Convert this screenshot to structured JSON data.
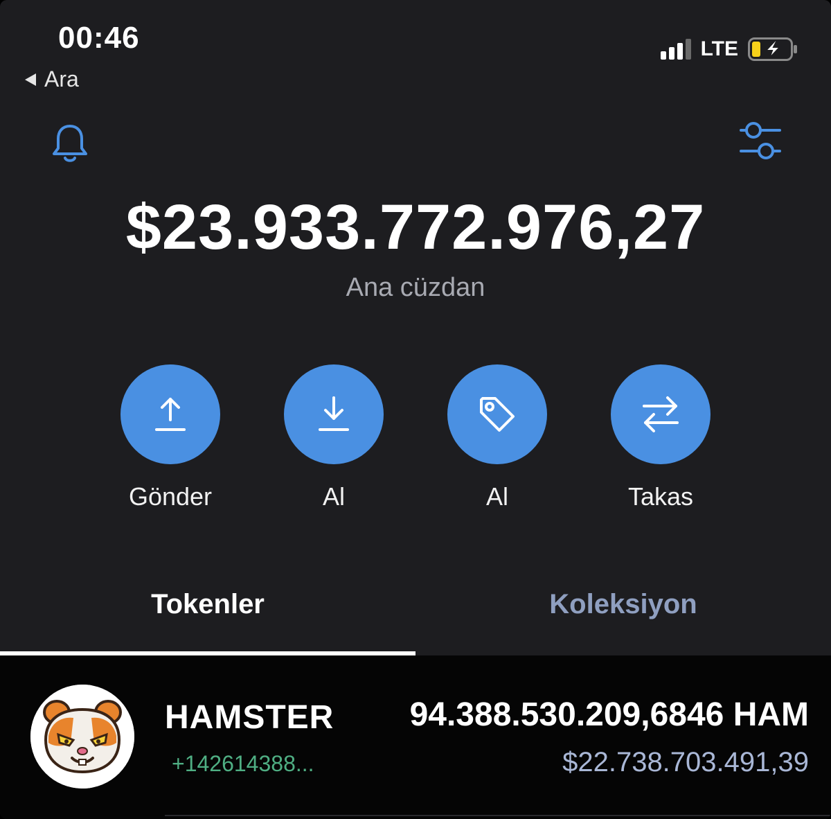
{
  "status_bar": {
    "time": "00:46",
    "back_label": "Ara",
    "network": "LTE",
    "battery_level": 0.3,
    "charging": true
  },
  "header": {
    "left_icon": "bell-icon",
    "right_icon": "sliders-icon",
    "accent_color": "#4a90e2"
  },
  "wallet": {
    "balance": "$23.933.772.976,27",
    "name": "Ana cüzdan"
  },
  "actions": [
    {
      "label": "Gönder",
      "icon": "upload-arrow-icon"
    },
    {
      "label": "Al",
      "icon": "download-arrow-icon"
    },
    {
      "label": "Al",
      "icon": "price-tag-icon"
    },
    {
      "label": "Takas",
      "icon": "swap-arrows-icon"
    }
  ],
  "tabs": [
    {
      "label": "Tokenler",
      "active": true
    },
    {
      "label": "Koleksiyon",
      "active": false
    }
  ],
  "tokens": [
    {
      "name": "HAMSTER",
      "change": "+142614388...",
      "amount": "94.388.530.209,6846 HAM",
      "value": "$22.738.703.491,39",
      "icon": "hamster-logo-icon"
    }
  ]
}
